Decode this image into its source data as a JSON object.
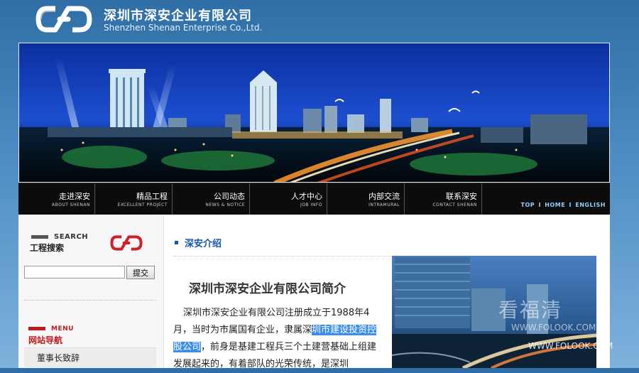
{
  "header": {
    "logo_icon": "chain-link-logo-icon",
    "company_cn": "深圳市深安企业有限公司",
    "company_en": "Shenzhen Shenan Enterprise Co.,Ltd."
  },
  "nav": {
    "items": [
      {
        "cn": "走进深安",
        "en": "ABOUT SHENAN"
      },
      {
        "cn": "精品工程",
        "en": "EXCELLENT PROJECT"
      },
      {
        "cn": "公司动态",
        "en": "NEWS & NOTICE"
      },
      {
        "cn": "人才中心",
        "en": "JOB INFO"
      },
      {
        "cn": "内部交流",
        "en": "INTRAMURAL"
      },
      {
        "cn": "联系深安",
        "en": "CONTACT SHENAN"
      }
    ],
    "top_links": [
      "TOP",
      "HOME",
      "ENGLISH"
    ],
    "separator": "I"
  },
  "sidebar": {
    "search_title_en": "SEARCH",
    "search_title_cn": "工程搜索",
    "search_input_value": "",
    "search_button": "提交",
    "menu_title_en": "MENU",
    "menu_title_cn": "网站导航",
    "menu_items": [
      "董事长致辞"
    ]
  },
  "main": {
    "section_title": "深安介绍",
    "article_title": "深圳市深安企业有限公司简介",
    "body_part1": "深圳市深安企业有限公司注册成立于1988年4月，当时为市属国有企业，隶属深",
    "body_highlight": "圳市建设投资控股公司",
    "body_part2": "，前身是基建工程兵三个土建营基础上组建发展起来的，有着部队的光荣传统，是深圳"
  },
  "watermark": {
    "cn": "看福清",
    "en1": "WWW.FOLOOK.COM",
    "en2": "WWW.FOLOOK.COM"
  },
  "colors": {
    "accent_blue": "#1a56b0",
    "menu_red": "#c0191e",
    "nav_bg": "#0c0c0c",
    "highlight": "#3d8ee5"
  }
}
